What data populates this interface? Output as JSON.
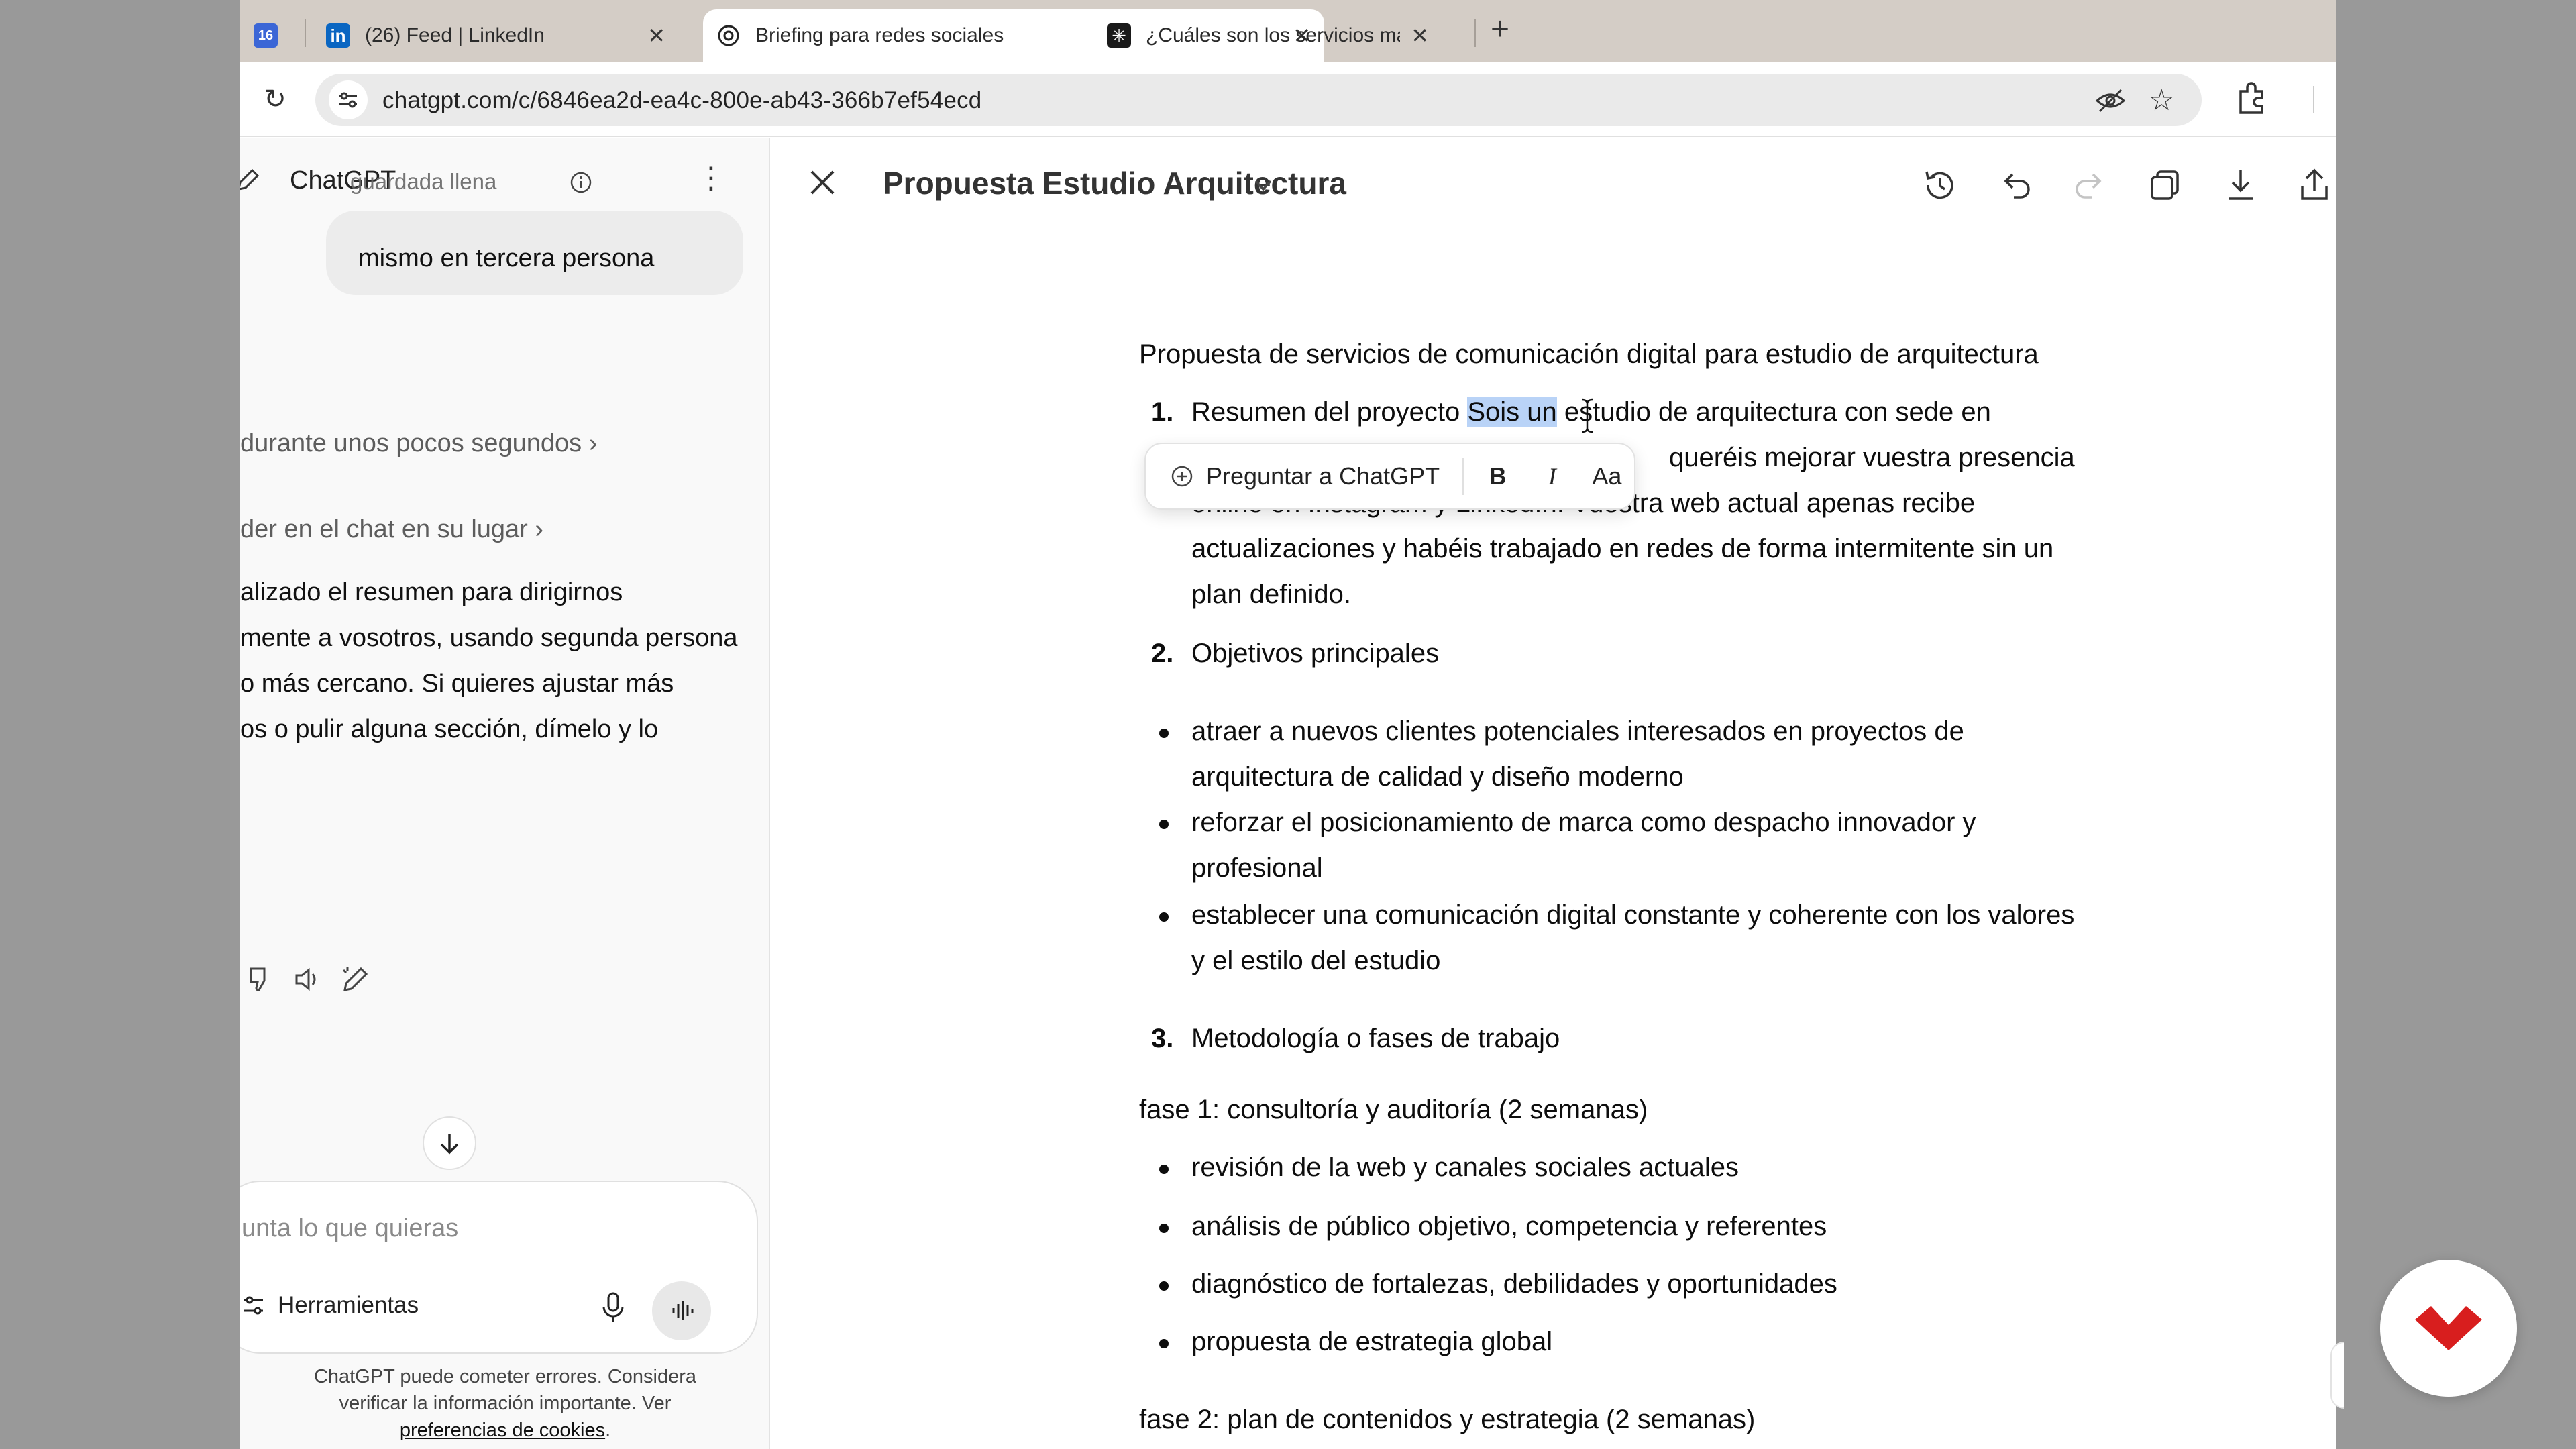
{
  "browser": {
    "tabs": [
      {
        "title": "",
        "icon": "calendar-icon",
        "active": false
      },
      {
        "title": "(26) Feed | LinkedIn",
        "icon": "linkedin-icon",
        "active": false
      },
      {
        "title": "Briefing para redes sociales",
        "icon": "openai-icon",
        "active": true
      },
      {
        "title": "¿Cuáles son los servicios más",
        "icon": "gemini-icon",
        "active": false
      }
    ],
    "new_tab": "+",
    "url": "chatgpt.com/c/6846ea2d-ea4c-800e-ab43-366b7ef54ecd"
  },
  "chat": {
    "header_title": "ChatGPT",
    "header_overlay": "guardada llena",
    "user_message": "mismo en tercera persona",
    "thought_1": "durante unos pocos segundos",
    "thought_2": "der en el chat en su lugar",
    "answer_lines": [
      "alizado el resumen para dirigirnos",
      "mente a vosotros, usando segunda persona",
      "o más cercano. Si quieres ajustar más",
      "os o pulir alguna sección, dímelo y lo"
    ],
    "composer_placeholder": "unta lo que quieras",
    "tools_label": "Herramientas",
    "disclaimer_line1": "ChatGPT puede cometer errores. Considera",
    "disclaimer_line2": "verificar la información importante. Ver",
    "disclaimer_link": "preferencias de cookies",
    "disclaimer_end": "."
  },
  "canvas": {
    "title": "Propuesta Estudio Arquitectura",
    "heading": "Propuesta de servicios de comunicación digital para estudio de arquitectura",
    "sections": [
      {
        "number": "1.",
        "lines": [
          {
            "before": "Resumen del proyecto ",
            "selected": "Sois un",
            "after": " estudio de arquitectura con sede en"
          },
          {
            "text": "queréis mejorar vuestra presencia"
          },
          {
            "text": "online en Instagram y LinkedIn. Vuestra web actual apenas recibe"
          },
          {
            "text": "actualizaciones y habéis trabajado en redes de forma intermitente sin un"
          },
          {
            "text": "plan definido."
          }
        ]
      },
      {
        "number": "2.",
        "title": "Objetivos principales"
      },
      {
        "number": "3.",
        "title": "Metodología o fases de trabajo"
      }
    ],
    "objectives": [
      [
        "atraer a nuevos clientes potenciales interesados en proyectos de",
        "arquitectura de calidad y diseño moderno"
      ],
      [
        "reforzar el posicionamiento de marca como despacho innovador y",
        "profesional"
      ],
      [
        "establecer una comunicación digital constante y coherente con los valores",
        "y el estilo del estudio"
      ]
    ],
    "phase1_title": "fase 1: consultoría y auditoría (2 semanas)",
    "phase1_items": [
      "revisión de la web y canales sociales actuales",
      "análisis de público objetivo, competencia y referentes",
      "diagnóstico de fortalezas, debilidades y oportunidades",
      "propuesta de estrategia global"
    ],
    "phase2_title": "fase 2: plan de contenidos y estrategia (2 semanas)",
    "format_toolbar": {
      "ask_label": "Preguntar a ChatGPT",
      "bold": "B",
      "italic": "I",
      "text_size": "Aa"
    }
  },
  "colors": {
    "selection": "#b9d3f7",
    "brand_red": "#d81e1e",
    "tabstrip": "#d4cdc6"
  }
}
